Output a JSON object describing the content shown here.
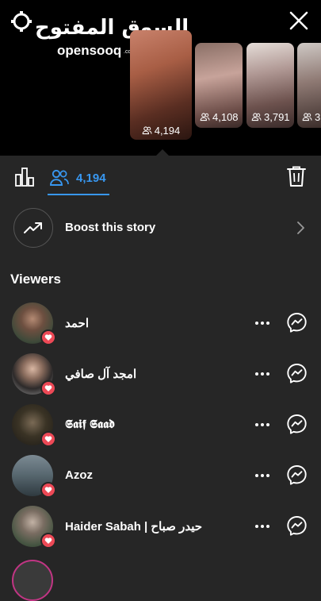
{
  "header": {
    "logo_arabic": "السوق المفتوح",
    "logo_latin": "opensooq",
    "logo_suffix": ".com"
  },
  "stories": [
    {
      "viewers": "4,194"
    },
    {
      "viewers": "4,108"
    },
    {
      "viewers": "3,791"
    },
    {
      "viewers": "3"
    }
  ],
  "tabs": {
    "viewers_count": "4,194"
  },
  "boost": {
    "label": "Boost this story"
  },
  "viewers": {
    "title": "Viewers",
    "items": [
      {
        "name": "احمد",
        "liked": true
      },
      {
        "name": "امجد آل صافي",
        "liked": true
      },
      {
        "name": "𝕾𝖆𝖎𝖋 𝕾𝖆𝖆𝖉",
        "liked": true
      },
      {
        "name": "Azoz",
        "liked": true
      },
      {
        "name": "Haider Sabah | حيدر صباح",
        "liked": true
      }
    ]
  },
  "colors": {
    "background": "#262626",
    "top_background": "#000000",
    "accent": "#3897f0",
    "heart": "#ed4956"
  }
}
